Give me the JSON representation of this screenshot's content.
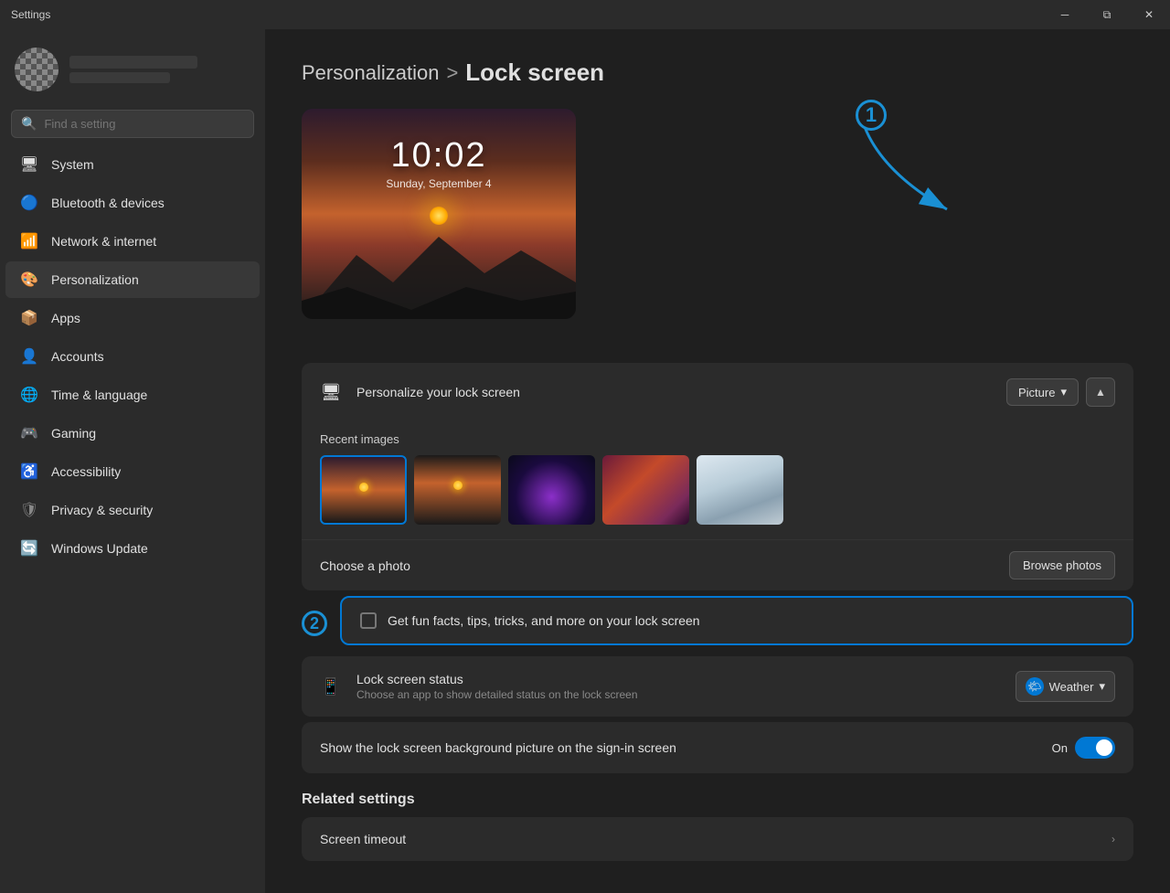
{
  "titlebar": {
    "title": "Settings",
    "minimize_label": "─",
    "maximize_label": "⧉",
    "close_label": "✕"
  },
  "sidebar": {
    "search_placeholder": "Find a setting",
    "nav_items": [
      {
        "id": "system",
        "label": "System",
        "icon": "🖥"
      },
      {
        "id": "bluetooth",
        "label": "Bluetooth & devices",
        "icon": "🔷"
      },
      {
        "id": "network",
        "label": "Network & internet",
        "icon": "📶"
      },
      {
        "id": "personalization",
        "label": "Personalization",
        "icon": "🎨",
        "active": true
      },
      {
        "id": "apps",
        "label": "Apps",
        "icon": "📦"
      },
      {
        "id": "accounts",
        "label": "Accounts",
        "icon": "👤"
      },
      {
        "id": "time",
        "label": "Time & language",
        "icon": "🌐"
      },
      {
        "id": "gaming",
        "label": "Gaming",
        "icon": "🎮"
      },
      {
        "id": "accessibility",
        "label": "Accessibility",
        "icon": "♿"
      },
      {
        "id": "privacy",
        "label": "Privacy & security",
        "icon": "🛡"
      },
      {
        "id": "windows_update",
        "label": "Windows Update",
        "icon": "🔄"
      }
    ]
  },
  "content": {
    "breadcrumb_parent": "Personalization",
    "breadcrumb_separator": ">",
    "breadcrumb_current": "Lock screen",
    "lockscreen": {
      "time": "10:02",
      "date": "Sunday, September 4"
    },
    "personalize_row": {
      "title": "Personalize your lock screen",
      "dropdown_label": "Picture",
      "icon": "🖥"
    },
    "recent_images_label": "Recent images",
    "choose_photo_label": "Choose a photo",
    "browse_photos_label": "Browse photos",
    "fun_facts_label": "Get fun facts, tips, tricks, and more on your lock screen",
    "lock_screen_status": {
      "title": "Lock screen status",
      "subtitle": "Choose an app to show detailed status on the lock screen",
      "weather_label": "Weather",
      "icon": "📱"
    },
    "show_background": {
      "title": "Show the lock screen background picture on the sign-in screen",
      "toggle_state": "On"
    },
    "related_settings_label": "Related settings",
    "screen_timeout_label": "Screen timeout"
  },
  "annotations": {
    "step1": "1",
    "step2": "2"
  }
}
